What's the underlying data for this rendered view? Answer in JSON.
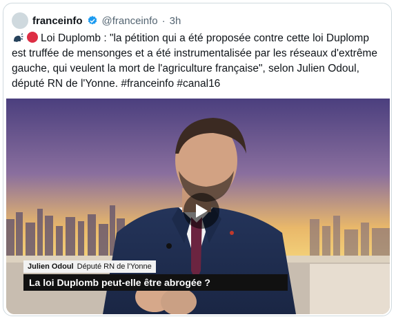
{
  "tweet": {
    "display_name": "franceinfo",
    "handle": "@franceinfo",
    "separator": "·",
    "time": "3h",
    "text_main": "Loi Duplomb : \"la pétition qui a été proposée contre cette loi Duplomp est truffée de mensonges et a été instrumentalisée par les réseaux d'extrême gauche, qui veulent la mort de l'agriculture française\", selon Julien Odoul, député RN de l'Yonne. ",
    "hashtags": [
      "#franceinfo",
      "#canal16"
    ],
    "icons": {
      "speaking": "speaking-head-icon",
      "red_circle": "red-circle-icon",
      "verified": "verified-badge-icon",
      "play": "play-icon"
    }
  },
  "video": {
    "lower_third_name": "Julien Odoul",
    "lower_third_role": "Député RN de l'Yonne",
    "lower_third_title": "La loi Duplomb peut-elle être abrogée ?"
  },
  "colors": {
    "verified_blue": "#1d9bf0",
    "studio_purple": "#5a4f8a",
    "studio_gold": "#f0c860"
  }
}
